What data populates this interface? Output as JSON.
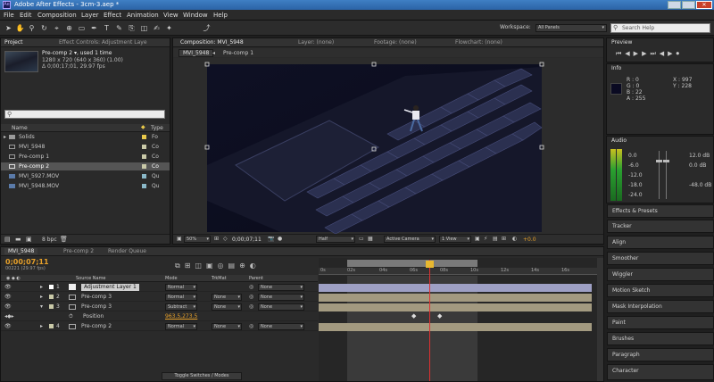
{
  "app": {
    "title": "Adobe After Effects - 3cm-3.aep *",
    "icon_label": "Ae"
  },
  "menu": [
    "File",
    "Edit",
    "Composition",
    "Layer",
    "Effect",
    "Animation",
    "View",
    "Window",
    "Help"
  ],
  "toolbar": {
    "workspace_label": "Workspace:",
    "workspace_value": "All Panels",
    "search_placeholder": "Search Help"
  },
  "project_panel": {
    "tabs": [
      "Project",
      "Effect Controls: Adjustment Laye"
    ],
    "item_name": "Pre-comp 2 ▾, used 1 time",
    "item_size": "1280 x 720  (640 x 360) (1.00)",
    "item_duration": "Δ 0;00;17;01, 29.97 fps",
    "search_placeholder": "",
    "col_name": "Name",
    "col_type": "Type",
    "items": [
      {
        "name": "Solids",
        "type": "Fo",
        "swatch": "#e8c84a"
      },
      {
        "name": "MVI_5948",
        "type": "Co",
        "swatch": "#c9c9a8"
      },
      {
        "name": "Pre-comp 1",
        "type": "Co",
        "swatch": "#c9c9a8"
      },
      {
        "name": "Pre-comp 2",
        "type": "Co",
        "swatch": "#c9c9a8"
      },
      {
        "name": "MVI_5927.MOV",
        "type": "Qu",
        "swatch": "#8ab8c8"
      },
      {
        "name": "MVI_5948.MOV",
        "type": "Qu",
        "swatch": "#8ab8c8"
      }
    ],
    "bpc": "8 bpc"
  },
  "comp_panel": {
    "tabs": [
      "Composition: MVI_5948",
      "Layer: (none)",
      "Footage: (none)",
      "Flowchart: (none)"
    ],
    "sub_tabs": [
      "MVI_5948",
      "Pre-comp 1"
    ],
    "zoom": "50%",
    "timecode": "0;00;07;11",
    "resolution": "Half",
    "camera": "Active Camera",
    "view": "1 View",
    "exposure": "+0.0"
  },
  "right_panels": {
    "preview_tab": "Preview",
    "info_tab": "Info",
    "info": {
      "r": "R : 0",
      "g": "G : 0",
      "b": "B : 22",
      "a": "A : 255",
      "x": "X : 997",
      "y": "Y : 228"
    },
    "audio_tab": "Audio",
    "audio_left": [
      "0.0",
      "-6.0",
      "-12.0",
      "-18.0",
      "-24.0"
    ],
    "audio_right": [
      "12.0 dB",
      "0.0 dB",
      "",
      "-48.0 dB",
      ""
    ],
    "panels": [
      "Effects & Presets",
      "Tracker",
      "Align",
      "Smoother",
      "Wiggler",
      "Motion Sketch",
      "Mask Interpolation",
      "Paint",
      "Brushes",
      "Paragraph",
      "Character"
    ]
  },
  "timeline": {
    "tabs": [
      "MVI_5948",
      "Pre-comp 2",
      "Render Queue"
    ],
    "timecode": "0;00;07;11",
    "frame_info": "00221 (29.97 fps)",
    "col_source": "Source Name",
    "col_mode": "Mode",
    "col_trkmat": "TrkMat",
    "col_parent": "Parent",
    "ruler": [
      "0s",
      "02s",
      "04s",
      "06s",
      "08s",
      "10s",
      "12s",
      "14s",
      "16s"
    ],
    "layers": [
      {
        "num": "1",
        "name": "Adjustment Layer 1",
        "mode": "Normal",
        "trk": "",
        "parent": "None",
        "color": "#ffffff"
      },
      {
        "num": "2",
        "name": "Pre-comp 3",
        "mode": "Normal",
        "trk": "None",
        "parent": "None",
        "color": "#c9c9a8"
      },
      {
        "num": "3",
        "name": "Pre-comp 3",
        "mode": "Subtract",
        "trk": "None",
        "parent": "None",
        "color": "#c9c9a8"
      },
      {
        "num": "4",
        "name": "Pre-comp 2",
        "mode": "Normal",
        "trk": "None",
        "parent": "None",
        "color": "#c9c9a8"
      }
    ],
    "property_name": "Position",
    "property_value": "963.5,273.5",
    "footer": "Toggle Switches / Modes"
  },
  "colors": {
    "accent_blue": "#2b63a6",
    "orange": "#e6a02a",
    "playhead": "#e03030",
    "canvas": "#0c0d1f"
  }
}
